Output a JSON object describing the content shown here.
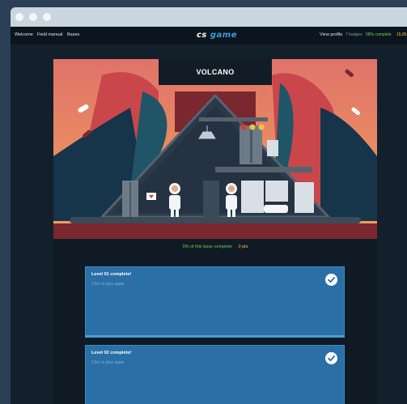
{
  "nav": {
    "links": [
      "Welcome",
      "Field manual",
      "Bases"
    ],
    "logo_part1": "cs",
    "logo_part2": "game",
    "profile_link": "View profile",
    "badges": "7 badges",
    "complete": "58% complete",
    "points": "15,80"
  },
  "base": {
    "name": "VOLCANO",
    "progress_text": "0% of this base complete",
    "points_text": "0 pts"
  },
  "levels": [
    {
      "title": "Level 01 complete!",
      "subtitle": "Click to play again"
    },
    {
      "title": "Level 02 complete!",
      "subtitle": "Click to play again"
    }
  ],
  "colors": {
    "accent": "#3a9fd9",
    "nav_bg": "#0c151d",
    "card": "#2a6fa5",
    "complete_green": "#79c957",
    "points_yellow": "#f3c33c",
    "volcano_red": "#c9474b",
    "sky": "#e88a5e"
  },
  "icons": [
    "checkmark-icon",
    "window-dot-icon"
  ]
}
